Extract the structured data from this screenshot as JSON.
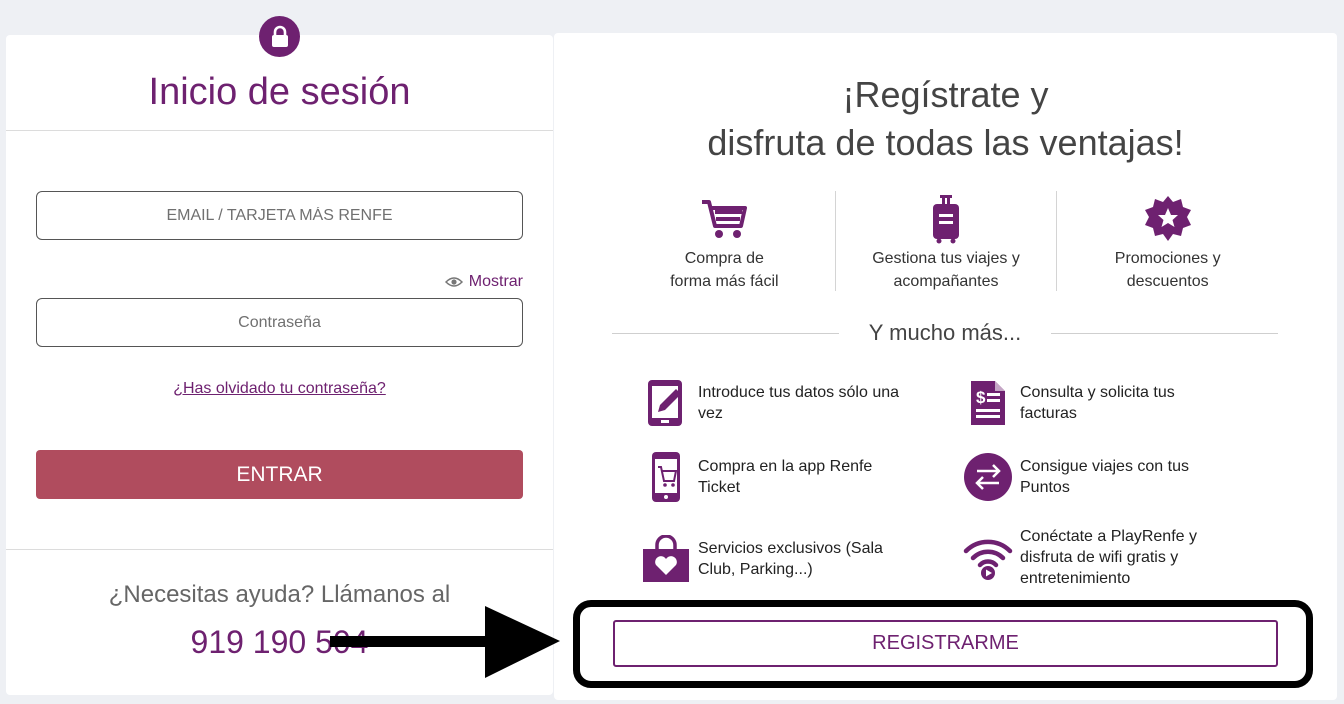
{
  "login": {
    "title": "Inicio de sesión",
    "email_placeholder": "EMAIL / TARJETA MÁS RENFE",
    "show_label": "Mostrar",
    "password_placeholder": "Contraseña",
    "forgot_label": "¿Has olvidado tu contraseña?",
    "enter_label": "ENTRAR",
    "help_text": "¿Necesitas ayuda? Llámanos al",
    "help_phone": "919 190 504"
  },
  "register": {
    "title_line1": "¡Regístrate y",
    "title_line2": "disfruta de todas las ventajas!",
    "benefits": [
      {
        "icon": "shopping-cart-icon",
        "line1": "Compra de",
        "line2": "forma más fácil"
      },
      {
        "icon": "luggage-icon",
        "line1": "Gestiona tus viajes y",
        "line2": "acompañantes"
      },
      {
        "icon": "star-badge-icon",
        "line1": "Promociones y",
        "line2": "descuentos"
      }
    ],
    "more_label": "Y mucho más...",
    "features": [
      {
        "icon": "edit-tablet-icon",
        "text": "Introduce tus datos sólo una vez"
      },
      {
        "icon": "invoice-icon",
        "text": "Consulta y solicita tus facturas"
      },
      {
        "icon": "mobile-cart-icon",
        "text": "Compra en la app Renfe Ticket"
      },
      {
        "icon": "exchange-arrows-icon",
        "text": "Consigue viajes con tus Puntos"
      },
      {
        "icon": "bag-heart-icon",
        "text": "Servicios exclusivos (Sala Club, Parking...)"
      },
      {
        "icon": "wifi-play-icon",
        "text": "Conéctate a PlayRenfe y disfruta de wifi gratis y entretenimiento"
      }
    ],
    "register_label": "REGISTRARME"
  },
  "colors": {
    "brand_purple": "#6e2170",
    "enter_button": "#b04c5e",
    "annotation": "#000000"
  }
}
